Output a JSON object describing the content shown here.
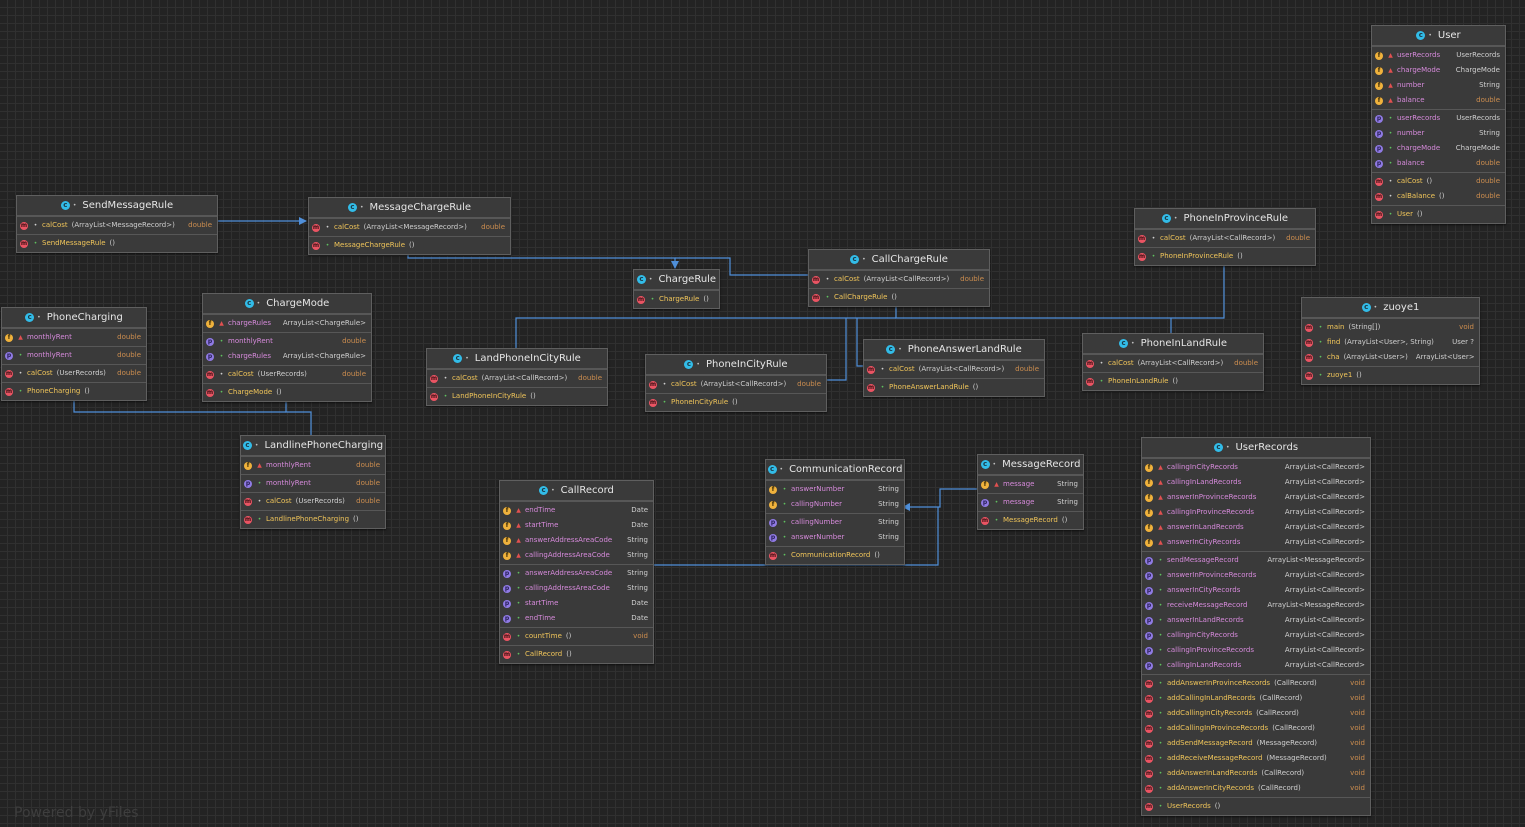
{
  "watermark": "Powered by yFiles",
  "colors": {
    "background": "#232323",
    "node_fill": "#3a3a3a",
    "edge": "#4f8fd9",
    "field_icon": "#f0b23c",
    "property_icon": "#8f7ae3",
    "method_icon": "#ea5463",
    "class_icon": "#32bce8",
    "primitive_type": "#cc8d4f"
  },
  "classes": [
    {
      "id": "User",
      "name": "User",
      "sections": [
        [
          {
            "kind": "f",
            "vis": "pri",
            "name": "userRecords",
            "type": "UserRecords"
          },
          {
            "kind": "f",
            "vis": "pri",
            "name": "chargeMode",
            "type": "ChargeMode"
          },
          {
            "kind": "f",
            "vis": "pri",
            "name": "number",
            "type": "String"
          },
          {
            "kind": "f",
            "vis": "pri",
            "name": "balance",
            "type": "double",
            "prim": true
          }
        ],
        [
          {
            "kind": "p",
            "vis": "pub",
            "name": "userRecords",
            "type": "UserRecords"
          },
          {
            "kind": "p",
            "vis": "pub",
            "name": "number",
            "type": "String"
          },
          {
            "kind": "p",
            "vis": "pub",
            "name": "chargeMode",
            "type": "ChargeMode"
          },
          {
            "kind": "p",
            "vis": "pub",
            "name": "balance",
            "type": "double",
            "prim": true
          }
        ],
        [
          {
            "kind": "m",
            "vis": "pkg",
            "name": "calCost",
            "params": "()",
            "type": "double",
            "prim": true
          },
          {
            "kind": "m",
            "vis": "pkg",
            "name": "calBalance",
            "params": "()",
            "type": "double",
            "prim": true
          }
        ],
        [
          {
            "kind": "m",
            "vis": "pub",
            "name": "User",
            "params": "()",
            "type": ""
          }
        ]
      ]
    },
    {
      "id": "SendMessageRule",
      "name": "SendMessageRule",
      "sections": [
        [
          {
            "kind": "m",
            "vis": "pkg",
            "name": "calCost",
            "params": "(ArrayList<MessageRecord>)",
            "type": "double",
            "prim": true
          }
        ],
        [
          {
            "kind": "m",
            "vis": "pub",
            "name": "SendMessageRule",
            "params": "()",
            "type": ""
          }
        ]
      ]
    },
    {
      "id": "MessageChargeRule",
      "name": "MessageChargeRule",
      "sections": [
        [
          {
            "kind": "m",
            "vis": "pkg",
            "name": "calCost",
            "params": "(ArrayList<MessageRecord>)",
            "type": "double",
            "prim": true
          }
        ],
        [
          {
            "kind": "m",
            "vis": "pub",
            "name": "MessageChargeRule",
            "params": "()",
            "type": ""
          }
        ]
      ]
    },
    {
      "id": "ChargeRule",
      "name": "ChargeRule",
      "sections": [
        [
          {
            "kind": "m",
            "vis": "pub",
            "name": "ChargeRule",
            "params": "()",
            "type": ""
          }
        ]
      ]
    },
    {
      "id": "CallChargeRule",
      "name": "CallChargeRule",
      "sections": [
        [
          {
            "kind": "m",
            "vis": "pkg",
            "name": "calCost",
            "params": "(ArrayList<CallRecord>)",
            "type": "double",
            "prim": true
          }
        ],
        [
          {
            "kind": "m",
            "vis": "pub",
            "name": "CallChargeRule",
            "params": "()",
            "type": ""
          }
        ]
      ]
    },
    {
      "id": "PhoneInProvinceRule",
      "name": "PhoneInProvinceRule",
      "sections": [
        [
          {
            "kind": "m",
            "vis": "pkg",
            "name": "calCost",
            "params": "(ArrayList<CallRecord>)",
            "type": "double",
            "prim": true
          }
        ],
        [
          {
            "kind": "m",
            "vis": "pub",
            "name": "PhoneInProvinceRule",
            "params": "()",
            "type": ""
          }
        ]
      ]
    },
    {
      "id": "zuoye1",
      "name": "zuoye1",
      "sections": [
        [
          {
            "kind": "m",
            "vis": "pub",
            "name": "main",
            "params": "(String[])",
            "type": "void",
            "prim": true
          },
          {
            "kind": "m",
            "vis": "pub",
            "name": "find",
            "params": "(ArrayList<User>, String)",
            "type": "User ?"
          },
          {
            "kind": "m",
            "vis": "pub",
            "name": "cha",
            "params": "(ArrayList<User>)",
            "type": "ArrayList<User>"
          }
        ],
        [
          {
            "kind": "m",
            "vis": "pub",
            "name": "zuoye1",
            "params": "()",
            "type": ""
          }
        ]
      ]
    },
    {
      "id": "PhoneCharging",
      "name": "PhoneCharging",
      "sections": [
        [
          {
            "kind": "f",
            "vis": "pri",
            "name": "monthlyRent",
            "type": "double",
            "prim": true
          }
        ],
        [
          {
            "kind": "p",
            "vis": "pub",
            "name": "monthlyRent",
            "type": "double",
            "prim": true
          }
        ],
        [
          {
            "kind": "m",
            "vis": "pkg",
            "name": "calCost",
            "params": "(UserRecords)",
            "type": "double",
            "prim": true
          }
        ],
        [
          {
            "kind": "m",
            "vis": "pub",
            "name": "PhoneCharging",
            "params": "()",
            "type": ""
          }
        ]
      ]
    },
    {
      "id": "ChargeMode",
      "name": "ChargeMode",
      "sections": [
        [
          {
            "kind": "f",
            "vis": "pri",
            "name": "chargeRules",
            "type": "ArrayList<ChargeRule>"
          }
        ],
        [
          {
            "kind": "p",
            "vis": "pub",
            "name": "monthlyRent",
            "type": "double",
            "prim": true
          },
          {
            "kind": "p",
            "vis": "pub",
            "name": "chargeRules",
            "type": "ArrayList<ChargeRule>"
          }
        ],
        [
          {
            "kind": "m",
            "vis": "pkg",
            "name": "calCost",
            "params": "(UserRecords)",
            "type": "double",
            "prim": true
          }
        ],
        [
          {
            "kind": "m",
            "vis": "pub",
            "name": "ChargeMode",
            "params": "()",
            "type": ""
          }
        ]
      ]
    },
    {
      "id": "LandPhoneInCityRule",
      "name": "LandPhoneInCityRule",
      "sections": [
        [
          {
            "kind": "m",
            "vis": "pkg",
            "name": "calCost",
            "params": "(ArrayList<CallRecord>)",
            "type": "double",
            "prim": true
          }
        ],
        [
          {
            "kind": "m",
            "vis": "pub",
            "name": "LandPhoneInCityRule",
            "params": "()",
            "type": ""
          }
        ]
      ]
    },
    {
      "id": "PhoneInCityRule",
      "name": "PhoneInCityRule",
      "sections": [
        [
          {
            "kind": "m",
            "vis": "pkg",
            "name": "calCost",
            "params": "(ArrayList<CallRecord>)",
            "type": "double",
            "prim": true
          }
        ],
        [
          {
            "kind": "m",
            "vis": "pub",
            "name": "PhoneInCityRule",
            "params": "()",
            "type": ""
          }
        ]
      ]
    },
    {
      "id": "PhoneAnswerLandRule",
      "name": "PhoneAnswerLandRule",
      "sections": [
        [
          {
            "kind": "m",
            "vis": "pkg",
            "name": "calCost",
            "params": "(ArrayList<CallRecord>)",
            "type": "double",
            "prim": true
          }
        ],
        [
          {
            "kind": "m",
            "vis": "pub",
            "name": "PhoneAnswerLandRule",
            "params": "()",
            "type": ""
          }
        ]
      ]
    },
    {
      "id": "PhoneInLandRule",
      "name": "PhoneInLandRule",
      "sections": [
        [
          {
            "kind": "m",
            "vis": "pkg",
            "name": "calCost",
            "params": "(ArrayList<CallRecord>)",
            "type": "double",
            "prim": true
          }
        ],
        [
          {
            "kind": "m",
            "vis": "pub",
            "name": "PhoneInLandRule",
            "params": "()",
            "type": ""
          }
        ]
      ]
    },
    {
      "id": "LandlinePhoneCharging",
      "name": "LandlinePhoneCharging",
      "sections": [
        [
          {
            "kind": "f",
            "vis": "pri",
            "name": "monthlyRent",
            "type": "double",
            "prim": true
          }
        ],
        [
          {
            "kind": "p",
            "vis": "pub",
            "name": "monthlyRent",
            "type": "double",
            "prim": true
          }
        ],
        [
          {
            "kind": "m",
            "vis": "pkg",
            "name": "calCost",
            "params": "(UserRecords)",
            "type": "double",
            "prim": true
          }
        ],
        [
          {
            "kind": "m",
            "vis": "pub",
            "name": "LandlinePhoneCharging",
            "params": "()",
            "type": ""
          }
        ]
      ]
    },
    {
      "id": "CommunicationRecord",
      "name": "CommunicationRecord",
      "sections": [
        [
          {
            "kind": "f",
            "vis": "pub",
            "name": "answerNumber",
            "type": "String"
          },
          {
            "kind": "f",
            "vis": "pub",
            "name": "callingNumber",
            "type": "String"
          }
        ],
        [
          {
            "kind": "p",
            "vis": "pub",
            "name": "callingNumber",
            "type": "String"
          },
          {
            "kind": "p",
            "vis": "pub",
            "name": "answerNumber",
            "type": "String"
          }
        ],
        [
          {
            "kind": "m",
            "vis": "pub",
            "name": "CommunicationRecord",
            "params": "()",
            "type": ""
          }
        ]
      ]
    },
    {
      "id": "MessageRecord",
      "name": "MessageRecord",
      "sections": [
        [
          {
            "kind": "f",
            "vis": "pri",
            "name": "message",
            "type": "String"
          }
        ],
        [
          {
            "kind": "p",
            "vis": "pub",
            "name": "message",
            "type": "String"
          }
        ],
        [
          {
            "kind": "m",
            "vis": "pub",
            "name": "MessageRecord",
            "params": "()",
            "type": ""
          }
        ]
      ]
    },
    {
      "id": "CallRecord",
      "name": "CallRecord",
      "sections": [
        [
          {
            "kind": "f",
            "vis": "pri",
            "name": "endTime",
            "type": "Date"
          },
          {
            "kind": "f",
            "vis": "pri",
            "name": "startTime",
            "type": "Date"
          },
          {
            "kind": "f",
            "vis": "pri",
            "name": "answerAddressAreaCode",
            "type": "String"
          },
          {
            "kind": "f",
            "vis": "pri",
            "name": "callingAddressAreaCode",
            "type": "String"
          }
        ],
        [
          {
            "kind": "p",
            "vis": "pub",
            "name": "answerAddressAreaCode",
            "type": "String"
          },
          {
            "kind": "p",
            "vis": "pub",
            "name": "callingAddressAreaCode",
            "type": "String"
          },
          {
            "kind": "p",
            "vis": "pub",
            "name": "startTime",
            "type": "Date"
          },
          {
            "kind": "p",
            "vis": "pub",
            "name": "endTime",
            "type": "Date"
          }
        ],
        [
          {
            "kind": "m",
            "vis": "pub",
            "name": "countTime",
            "params": "()",
            "type": "void",
            "prim": true
          }
        ],
        [
          {
            "kind": "m",
            "vis": "pub",
            "name": "CallRecord",
            "params": "()",
            "type": ""
          }
        ]
      ]
    },
    {
      "id": "UserRecords",
      "name": "UserRecords",
      "sections": [
        [
          {
            "kind": "f",
            "vis": "pri",
            "name": "callingInCityRecords",
            "type": "ArrayList<CallRecord>"
          },
          {
            "kind": "f",
            "vis": "pri",
            "name": "callingInLandRecords",
            "type": "ArrayList<CallRecord>"
          },
          {
            "kind": "f",
            "vis": "pri",
            "name": "answerInProvinceRecords",
            "type": "ArrayList<CallRecord>"
          },
          {
            "kind": "f",
            "vis": "pri",
            "name": "callingInProvinceRecords",
            "type": "ArrayList<CallRecord>"
          },
          {
            "kind": "f",
            "vis": "pri",
            "name": "answerInLandRecords",
            "type": "ArrayList<CallRecord>"
          },
          {
            "kind": "f",
            "vis": "pri",
            "name": "answerInCityRecords",
            "type": "ArrayList<CallRecord>"
          }
        ],
        [
          {
            "kind": "p",
            "vis": "pub",
            "name": "sendMessageRecord",
            "type": "ArrayList<MessageRecord>"
          },
          {
            "kind": "p",
            "vis": "pub",
            "name": "answerInProvinceRecords",
            "type": "ArrayList<CallRecord>"
          },
          {
            "kind": "p",
            "vis": "pub",
            "name": "answerInCityRecords",
            "type": "ArrayList<CallRecord>"
          },
          {
            "kind": "p",
            "vis": "pub",
            "name": "receiveMessageRecord",
            "type": "ArrayList<MessageRecord>"
          },
          {
            "kind": "p",
            "vis": "pub",
            "name": "answerInLandRecords",
            "type": "ArrayList<CallRecord>"
          },
          {
            "kind": "p",
            "vis": "pub",
            "name": "callingInCityRecords",
            "type": "ArrayList<CallRecord>"
          },
          {
            "kind": "p",
            "vis": "pub",
            "name": "callingInProvinceRecords",
            "type": "ArrayList<CallRecord>"
          },
          {
            "kind": "p",
            "vis": "pub",
            "name": "callingInLandRecords",
            "type": "ArrayList<CallRecord>"
          }
        ],
        [
          {
            "kind": "m",
            "vis": "pub",
            "name": "addAnswerInProvinceRecords",
            "params": "(CallRecord)",
            "type": "void",
            "prim": true
          },
          {
            "kind": "m",
            "vis": "pub",
            "name": "addCallingInLandRecords",
            "params": "(CallRecord)",
            "type": "void",
            "prim": true
          },
          {
            "kind": "m",
            "vis": "pub",
            "name": "addCallingInCityRecords",
            "params": "(CallRecord)",
            "type": "void",
            "prim": true
          },
          {
            "kind": "m",
            "vis": "pub",
            "name": "addCallingInProvinceRecords",
            "params": "(CallRecord)",
            "type": "void",
            "prim": true
          },
          {
            "kind": "m",
            "vis": "pub",
            "name": "addSendMessageRecord",
            "params": "(MessageRecord)",
            "type": "void",
            "prim": true
          },
          {
            "kind": "m",
            "vis": "pub",
            "name": "addReceiveMessageRecord",
            "params": "(MessageRecord)",
            "type": "void",
            "prim": true
          },
          {
            "kind": "m",
            "vis": "pub",
            "name": "addAnswerInLandRecords",
            "params": "(CallRecord)",
            "type": "void",
            "prim": true
          },
          {
            "kind": "m",
            "vis": "pub",
            "name": "addAnswerInCityRecords",
            "params": "(CallRecord)",
            "type": "void",
            "prim": true
          }
        ],
        [
          {
            "kind": "m",
            "vis": "pub",
            "name": "UserRecords",
            "params": "()",
            "type": ""
          }
        ]
      ]
    }
  ]
}
